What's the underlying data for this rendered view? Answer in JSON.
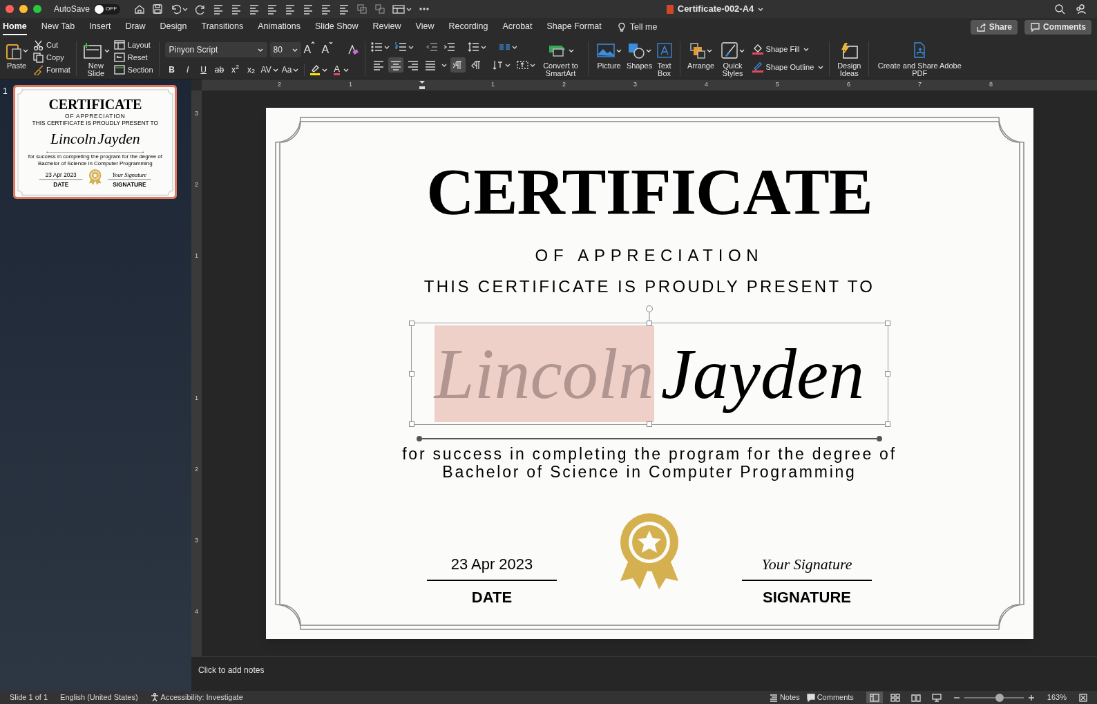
{
  "title_bar": {
    "autosave_label": "AutoSave",
    "autosave": {
      "on": false,
      "label": "OFF"
    },
    "document_title": "Certificate-002-A4"
  },
  "tabs": [
    {
      "label": "Home",
      "selected": true
    },
    {
      "label": "New Tab",
      "selected": false
    },
    {
      "label": "Insert",
      "selected": false
    },
    {
      "label": "Draw",
      "selected": false
    },
    {
      "label": "Design",
      "selected": false
    },
    {
      "label": "Transitions",
      "selected": false
    },
    {
      "label": "Animations",
      "selected": false
    },
    {
      "label": "Slide Show",
      "selected": false
    },
    {
      "label": "Review",
      "selected": false
    },
    {
      "label": "View",
      "selected": false
    },
    {
      "label": "Recording",
      "selected": false
    },
    {
      "label": "Acrobat",
      "selected": false
    },
    {
      "label": "Shape Format",
      "selected": false
    }
  ],
  "tell_me": "Tell me",
  "share": "Share",
  "comments": "Comments",
  "ribbon": {
    "paste": "Paste",
    "cut": "Cut",
    "copy": "Copy",
    "format": "Format",
    "new_slide": "New Slide",
    "layout": "Layout",
    "reset": "Reset",
    "section": "Section",
    "font_name": "Pinyon Script",
    "font_size": "80",
    "size_buttons": [
      "A",
      "A"
    ],
    "format_buttons": [
      "B",
      "I",
      "U",
      "ab",
      "x$^{2}$",
      "x$_{2}$",
      "AV",
      "Aa"
    ],
    "font_color": "A",
    "alignment": [
      {
        "selected": false
      },
      {
        "selected": true
      },
      {
        "selected": false
      },
      {
        "selected": false
      }
    ],
    "direction": [
      {
        "selected": true
      },
      {
        "selected": false
      }
    ],
    "smartart": "Convert to SmartArt",
    "picture": "Picture",
    "shapes": "Shapes",
    "text_box": "Text Box",
    "arrange": "Arrange",
    "quick_styles": "Quick Styles",
    "shape_fill": "Shape Fill",
    "shape_outline": "Shape Outline",
    "design_ideas": "Design Ideas",
    "adobe_pdf": "Create and Share Adobe PDF"
  },
  "thumbnails": [
    {
      "number": "1",
      "selected": true,
      "content": {
        "title": "CERTIFICATE",
        "subtitle": "OF APPRECIATION",
        "presented": "THIS CERTIFICATE IS PROUDLY PRESENT TO",
        "name": [
          {
            "text": "Lincoln"
          },
          {
            "text": "Jayden"
          }
        ],
        "description": [
          "for success in completing the program for the degree of",
          "Bachelor of Science in Computer Programming"
        ],
        "date": "23 Apr 2023",
        "date_label": "DATE",
        "signature": "Your Signature",
        "signature_label": "SIGNATURE"
      }
    }
  ],
  "ruler": {
    "horizontal": [
      "2",
      "1",
      "1",
      "2",
      "3",
      "4",
      "5",
      "6",
      "7",
      "8"
    ],
    "vertical": [
      "3",
      "2",
      "1",
      "1",
      "2",
      "3",
      "4"
    ]
  },
  "slide": {
    "title": "CERTIFICATE",
    "subtitle": "OF APPRECIATION",
    "presented": "THIS CERTIFICATE IS PROUDLY PRESENT TO",
    "name": [
      {
        "text": "Lincoln",
        "selected": true
      },
      {
        "text": "Jayden",
        "selected": false
      }
    ],
    "description": [
      "for success in completing the program for the degree of",
      "Bachelor of Science in Computer Programming"
    ],
    "date": "23 Apr 2023",
    "date_label": "DATE",
    "signature": "Your Signature",
    "signature_label": "SIGNATURE"
  },
  "notes_placeholder": "Click to add notes",
  "status_bar": {
    "slide": "Slide 1 of 1",
    "language": "English (United States)",
    "accessibility": "Accessibility: Investigate",
    "notes": "Notes",
    "comments": "Comments",
    "views": [
      {
        "selected": true
      },
      {
        "selected": false
      },
      {
        "selected": false
      },
      {
        "selected": false
      }
    ],
    "zoom": {
      "level": 0.6
    },
    "zoom_label": "163%"
  }
}
